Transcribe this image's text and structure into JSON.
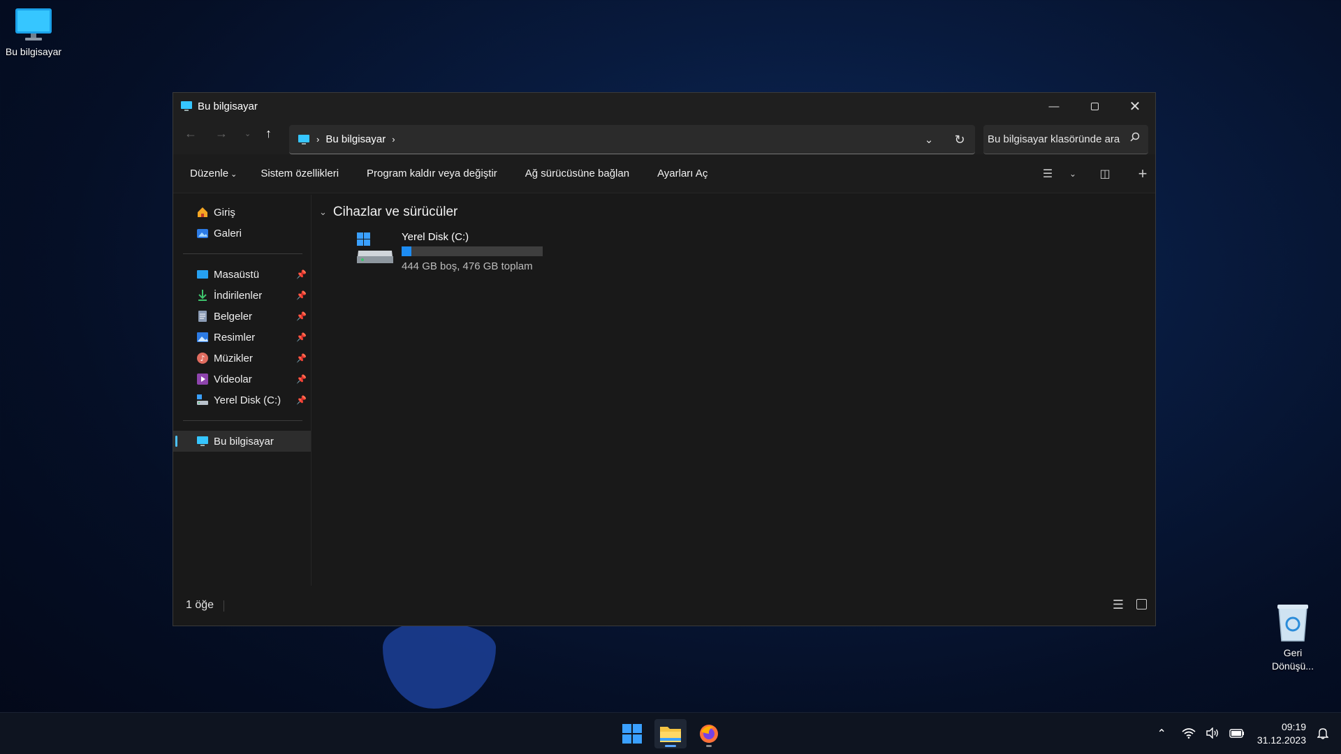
{
  "desktop": {
    "icons": [
      {
        "label": "Bu bilgisayar"
      },
      {
        "label": "Geri Dönüşü..."
      }
    ]
  },
  "window": {
    "title": "Bu bilgisayar",
    "address": {
      "path": [
        "Bu bilgisayar"
      ]
    },
    "search": {
      "placeholder": "Bu bilgisayar klasöründe ara"
    },
    "commands": [
      {
        "label": "Düzenle"
      },
      {
        "label": "Sistem özellikleri"
      },
      {
        "label": "Program kaldır veya değiştir"
      },
      {
        "label": "Ağ sürücüsüne bağlan"
      },
      {
        "label": "Ayarları Aç"
      }
    ],
    "sidebar": {
      "top": [
        {
          "label": "Giriş",
          "icon": "home-icon"
        },
        {
          "label": "Galeri",
          "icon": "gallery-icon"
        }
      ],
      "pinned": [
        {
          "label": "Masaüstü",
          "icon": "desktop-folder-icon"
        },
        {
          "label": "İndirilenler",
          "icon": "download-icon"
        },
        {
          "label": "Belgeler",
          "icon": "documents-icon"
        },
        {
          "label": "Resimler",
          "icon": "pictures-icon"
        },
        {
          "label": "Müzikler",
          "icon": "music-icon"
        },
        {
          "label": "Videolar",
          "icon": "videos-icon"
        },
        {
          "label": "Yerel Disk (C:)",
          "icon": "drive-icon"
        }
      ],
      "bottom": [
        {
          "label": "Bu bilgisayar",
          "icon": "computer-icon",
          "selected": true
        }
      ]
    },
    "content": {
      "group_title": "Cihazlar ve sürücüler",
      "drives": [
        {
          "name": "Yerel Disk (C:)",
          "info": "444 GB boş, 476 GB toplam",
          "used_fraction": 0.067
        }
      ]
    },
    "status": {
      "count": "1 öğe"
    }
  },
  "taskbar": {
    "apps": [
      "start-button",
      "file-explorer",
      "firefox"
    ],
    "clock": {
      "time": "09:19",
      "date": "31.12.2023"
    }
  },
  "colors": {
    "accent": "#4cc2ff",
    "drive_fill": "#1d8cf2",
    "window_bg": "#191919"
  }
}
